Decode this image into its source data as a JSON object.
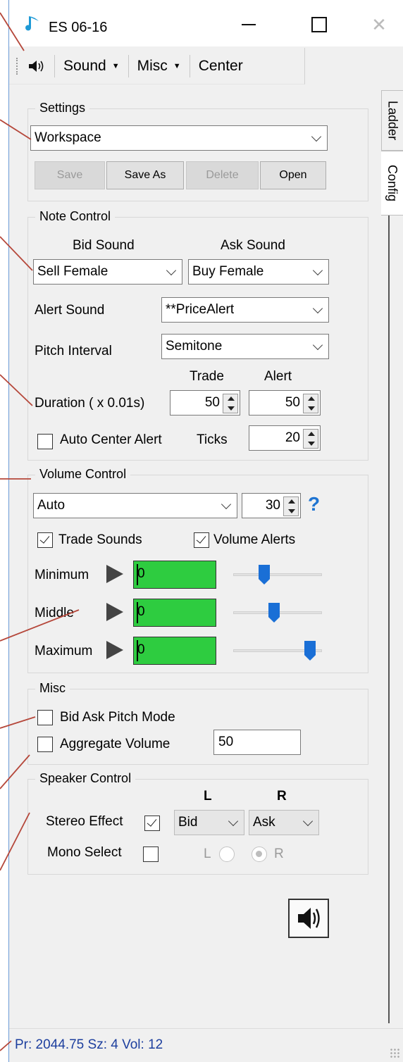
{
  "window": {
    "title": "ES 06-16"
  },
  "toolbar": {
    "sound_label": "Sound",
    "misc_label": "Misc",
    "center_label": "Center"
  },
  "tabs": [
    "Ladder",
    "Config"
  ],
  "settings": {
    "title": "Settings",
    "workspace_value": "Workspace",
    "buttons": {
      "save": "Save",
      "save_as": "Save As",
      "delete": "Delete",
      "open": "Open"
    }
  },
  "note_control": {
    "title": "Note Control",
    "bid_sound_label": "Bid Sound",
    "ask_sound_label": "Ask Sound",
    "bid_sound_value": "Sell Female",
    "ask_sound_value": "Buy Female",
    "alert_sound_label": "Alert Sound",
    "alert_sound_value": "**PriceAlert",
    "pitch_interval_label": "Pitch Interval",
    "pitch_interval_value": "Semitone",
    "trade_label": "Trade",
    "alert_label": "Alert",
    "duration_label": "Duration ( x 0.01s)",
    "duration_trade": "50",
    "duration_alert": "50",
    "auto_center_label": "Auto Center Alert",
    "auto_center_checked": false,
    "ticks_label": "Ticks",
    "ticks_value": "20"
  },
  "volume_control": {
    "title": "Volume Control",
    "mode_value": "Auto",
    "spin_value": "30",
    "help": "?",
    "trade_sounds_label": "Trade Sounds",
    "trade_sounds_checked": true,
    "volume_alerts_label": "Volume Alerts",
    "volume_alerts_checked": true,
    "rows": [
      {
        "label": "Minimum",
        "meter": "0",
        "slider_level": 0.33
      },
      {
        "label": "Middle",
        "meter": "0",
        "slider_level": 0.45
      },
      {
        "label": "Maximum",
        "meter": "0",
        "slider_level": 0.92
      }
    ],
    "meter_color": "#2ecc40"
  },
  "misc": {
    "title": "Misc",
    "bid_ask_pitch_label": "Bid Ask Pitch Mode",
    "bid_ask_pitch_checked": false,
    "aggregate_label": "Aggregate Volume",
    "aggregate_checked": false,
    "aggregate_value": "50"
  },
  "speaker_control": {
    "title": "Speaker Control",
    "l_header": "L",
    "r_header": "R",
    "stereo_label": "Stereo Effect",
    "stereo_checked": true,
    "l_value": "Bid",
    "r_value": "Ask",
    "mono_label": "Mono Select",
    "mono_checked": false,
    "radio_l": "L",
    "radio_r": "R",
    "selected_radio": "R"
  },
  "status": {
    "text": "Pr: 2044.75  Sz: 4  Vol: 12"
  },
  "colors": {
    "accent": "#1a6fd6",
    "leader_line": "#b5473a",
    "status_text": "#1d3f9e"
  },
  "icons": [
    "music-note-icon",
    "speaker-icon",
    "play-icon",
    "help-icon"
  ]
}
